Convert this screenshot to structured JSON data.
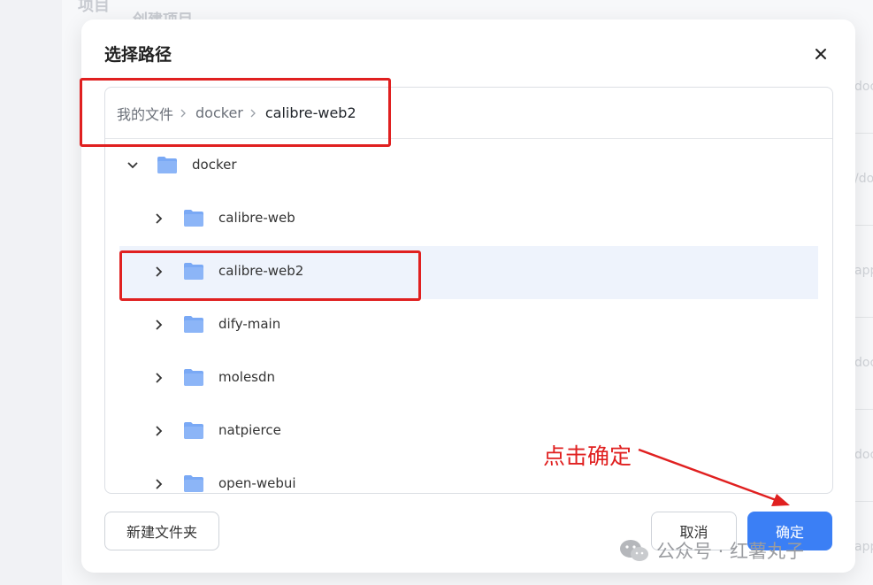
{
  "background": {
    "heading": "项目",
    "subheading": "创建项目",
    "side_fragments": [
      "docke",
      "/doc",
      "app/",
      "dock",
      "docke",
      "app"
    ]
  },
  "dialog": {
    "title": "选择路径"
  },
  "breadcrumb": {
    "items": [
      "我的文件",
      "docker",
      "calibre-web2"
    ]
  },
  "tree": {
    "root": "docker",
    "children": [
      "calibre-web",
      "calibre-web2",
      "dify-main",
      "molesdn",
      "natpierce",
      "open-webui"
    ],
    "selected": "calibre-web2"
  },
  "buttons": {
    "new_folder": "新建文件夹",
    "cancel": "取消",
    "confirm": "确定"
  },
  "annotation": {
    "text": "点击确定",
    "color": "#e02020"
  },
  "watermark": {
    "text": "公众号 · 红薯丸子"
  },
  "colors": {
    "primary": "#3b7ff5",
    "folder": "#7aa9f5",
    "highlight": "#e02020",
    "selected_row": "#eef3fc"
  },
  "icons": [
    "close-icon",
    "chevron-right-icon",
    "chevron-down-icon",
    "folder-icon",
    "wechat-icon"
  ]
}
